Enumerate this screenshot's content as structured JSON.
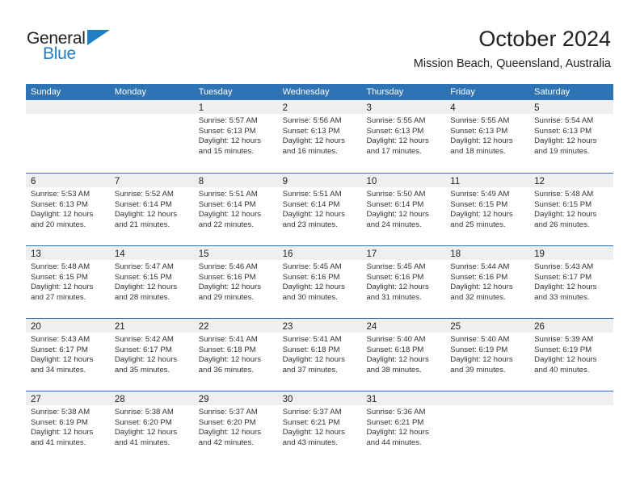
{
  "brand": {
    "name_part1": "General",
    "name_part2": "Blue",
    "flag_icon": "blue-triangle-flag",
    "color_dark": "#231f20",
    "color_blue": "#1f7ec4"
  },
  "header": {
    "title": "October 2024",
    "location": "Mission Beach, Queensland, Australia"
  },
  "theme": {
    "header_blue": "#2e74b5",
    "day_band_gray": "#efefef",
    "text": "#222222"
  },
  "weekdays": [
    "Sunday",
    "Monday",
    "Tuesday",
    "Wednesday",
    "Thursday",
    "Friday",
    "Saturday"
  ],
  "weeks": [
    [
      {
        "day": "",
        "lines": []
      },
      {
        "day": "",
        "lines": []
      },
      {
        "day": "1",
        "lines": [
          "Sunrise: 5:57 AM",
          "Sunset: 6:13 PM",
          "Daylight: 12 hours",
          "and 15 minutes."
        ]
      },
      {
        "day": "2",
        "lines": [
          "Sunrise: 5:56 AM",
          "Sunset: 6:13 PM",
          "Daylight: 12 hours",
          "and 16 minutes."
        ]
      },
      {
        "day": "3",
        "lines": [
          "Sunrise: 5:55 AM",
          "Sunset: 6:13 PM",
          "Daylight: 12 hours",
          "and 17 minutes."
        ]
      },
      {
        "day": "4",
        "lines": [
          "Sunrise: 5:55 AM",
          "Sunset: 6:13 PM",
          "Daylight: 12 hours",
          "and 18 minutes."
        ]
      },
      {
        "day": "5",
        "lines": [
          "Sunrise: 5:54 AM",
          "Sunset: 6:13 PM",
          "Daylight: 12 hours",
          "and 19 minutes."
        ]
      }
    ],
    [
      {
        "day": "6",
        "lines": [
          "Sunrise: 5:53 AM",
          "Sunset: 6:13 PM",
          "Daylight: 12 hours",
          "and 20 minutes."
        ]
      },
      {
        "day": "7",
        "lines": [
          "Sunrise: 5:52 AM",
          "Sunset: 6:14 PM",
          "Daylight: 12 hours",
          "and 21 minutes."
        ]
      },
      {
        "day": "8",
        "lines": [
          "Sunrise: 5:51 AM",
          "Sunset: 6:14 PM",
          "Daylight: 12 hours",
          "and 22 minutes."
        ]
      },
      {
        "day": "9",
        "lines": [
          "Sunrise: 5:51 AM",
          "Sunset: 6:14 PM",
          "Daylight: 12 hours",
          "and 23 minutes."
        ]
      },
      {
        "day": "10",
        "lines": [
          "Sunrise: 5:50 AM",
          "Sunset: 6:14 PM",
          "Daylight: 12 hours",
          "and 24 minutes."
        ]
      },
      {
        "day": "11",
        "lines": [
          "Sunrise: 5:49 AM",
          "Sunset: 6:15 PM",
          "Daylight: 12 hours",
          "and 25 minutes."
        ]
      },
      {
        "day": "12",
        "lines": [
          "Sunrise: 5:48 AM",
          "Sunset: 6:15 PM",
          "Daylight: 12 hours",
          "and 26 minutes."
        ]
      }
    ],
    [
      {
        "day": "13",
        "lines": [
          "Sunrise: 5:48 AM",
          "Sunset: 6:15 PM",
          "Daylight: 12 hours",
          "and 27 minutes."
        ]
      },
      {
        "day": "14",
        "lines": [
          "Sunrise: 5:47 AM",
          "Sunset: 6:15 PM",
          "Daylight: 12 hours",
          "and 28 minutes."
        ]
      },
      {
        "day": "15",
        "lines": [
          "Sunrise: 5:46 AM",
          "Sunset: 6:16 PM",
          "Daylight: 12 hours",
          "and 29 minutes."
        ]
      },
      {
        "day": "16",
        "lines": [
          "Sunrise: 5:45 AM",
          "Sunset: 6:16 PM",
          "Daylight: 12 hours",
          "and 30 minutes."
        ]
      },
      {
        "day": "17",
        "lines": [
          "Sunrise: 5:45 AM",
          "Sunset: 6:16 PM",
          "Daylight: 12 hours",
          "and 31 minutes."
        ]
      },
      {
        "day": "18",
        "lines": [
          "Sunrise: 5:44 AM",
          "Sunset: 6:16 PM",
          "Daylight: 12 hours",
          "and 32 minutes."
        ]
      },
      {
        "day": "19",
        "lines": [
          "Sunrise: 5:43 AM",
          "Sunset: 6:17 PM",
          "Daylight: 12 hours",
          "and 33 minutes."
        ]
      }
    ],
    [
      {
        "day": "20",
        "lines": [
          "Sunrise: 5:43 AM",
          "Sunset: 6:17 PM",
          "Daylight: 12 hours",
          "and 34 minutes."
        ]
      },
      {
        "day": "21",
        "lines": [
          "Sunrise: 5:42 AM",
          "Sunset: 6:17 PM",
          "Daylight: 12 hours",
          "and 35 minutes."
        ]
      },
      {
        "day": "22",
        "lines": [
          "Sunrise: 5:41 AM",
          "Sunset: 6:18 PM",
          "Daylight: 12 hours",
          "and 36 minutes."
        ]
      },
      {
        "day": "23",
        "lines": [
          "Sunrise: 5:41 AM",
          "Sunset: 6:18 PM",
          "Daylight: 12 hours",
          "and 37 minutes."
        ]
      },
      {
        "day": "24",
        "lines": [
          "Sunrise: 5:40 AM",
          "Sunset: 6:18 PM",
          "Daylight: 12 hours",
          "and 38 minutes."
        ]
      },
      {
        "day": "25",
        "lines": [
          "Sunrise: 5:40 AM",
          "Sunset: 6:19 PM",
          "Daylight: 12 hours",
          "and 39 minutes."
        ]
      },
      {
        "day": "26",
        "lines": [
          "Sunrise: 5:39 AM",
          "Sunset: 6:19 PM",
          "Daylight: 12 hours",
          "and 40 minutes."
        ]
      }
    ],
    [
      {
        "day": "27",
        "lines": [
          "Sunrise: 5:38 AM",
          "Sunset: 6:19 PM",
          "Daylight: 12 hours",
          "and 41 minutes."
        ]
      },
      {
        "day": "28",
        "lines": [
          "Sunrise: 5:38 AM",
          "Sunset: 6:20 PM",
          "Daylight: 12 hours",
          "and 41 minutes."
        ]
      },
      {
        "day": "29",
        "lines": [
          "Sunrise: 5:37 AM",
          "Sunset: 6:20 PM",
          "Daylight: 12 hours",
          "and 42 minutes."
        ]
      },
      {
        "day": "30",
        "lines": [
          "Sunrise: 5:37 AM",
          "Sunset: 6:21 PM",
          "Daylight: 12 hours",
          "and 43 minutes."
        ]
      },
      {
        "day": "31",
        "lines": [
          "Sunrise: 5:36 AM",
          "Sunset: 6:21 PM",
          "Daylight: 12 hours",
          "and 44 minutes."
        ]
      },
      {
        "day": "",
        "lines": []
      },
      {
        "day": "",
        "lines": []
      }
    ]
  ]
}
